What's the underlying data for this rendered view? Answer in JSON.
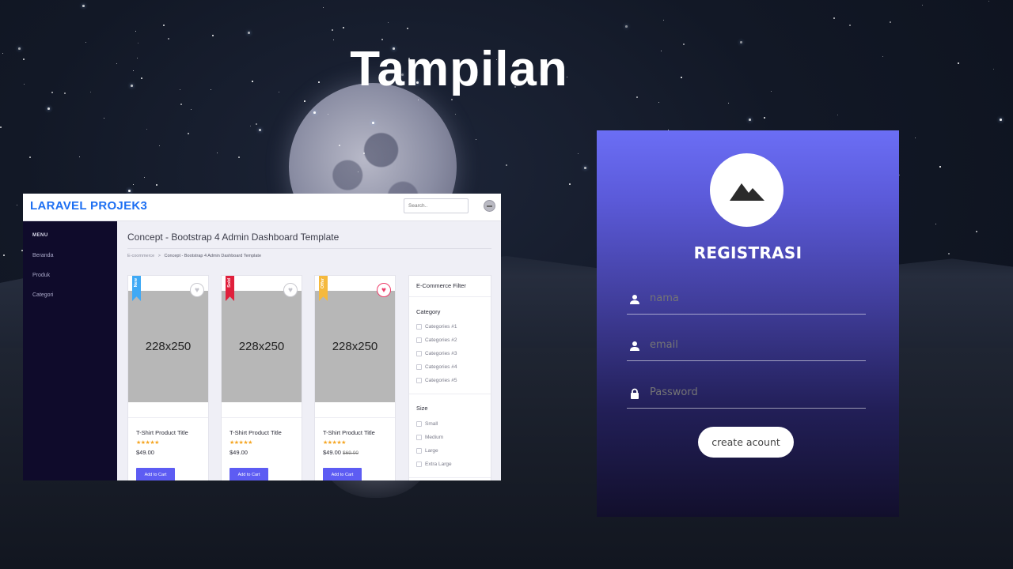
{
  "slide": {
    "title": "Tampilan"
  },
  "dashboard": {
    "brand": "LARAVEL PROJEK3",
    "search_placeholder": "Search..",
    "sidebar": {
      "menu_label": "MENU",
      "items": [
        {
          "label": "Beranda"
        },
        {
          "label": "Produk"
        },
        {
          "label": "Categori"
        }
      ]
    },
    "page_title": "Concept - Bootstrap 4 Admin Dashboard Template",
    "breadcrumb": {
      "root": "E-coommerce",
      "separator": ">",
      "current": "Concept - Bootstrap 4 Admin Dashboard Template"
    },
    "products": [
      {
        "ribbon": "New",
        "ribbon_color": "#3fa9f5",
        "image_text": "228x250",
        "title": "T-Shirt Product Title",
        "stars": "★★★★★",
        "price": "$49.00",
        "old_price": "",
        "cta": "Add to Cart",
        "favorited": false
      },
      {
        "ribbon": "Sold",
        "ribbon_color": "#e0203c",
        "image_text": "228x250",
        "title": "T-Shirt Product Title",
        "stars": "★★★★★",
        "price": "$49.00",
        "old_price": "",
        "cta": "Add to Cart",
        "favorited": false
      },
      {
        "ribbon": "Offer",
        "ribbon_color": "#f5b93d",
        "image_text": "228x250",
        "title": "T-Shirt Product Title",
        "stars": "★★★★★",
        "price": "$49.00",
        "old_price": "$69.00",
        "cta": "Add to Cart",
        "favorited": true
      }
    ],
    "filter": {
      "title": "E-Commerce Filter",
      "category_heading": "Category",
      "categories": [
        "Categories #1",
        "Categories #2",
        "Categories #3",
        "Categories #4",
        "Categories #5"
      ],
      "size_heading": "Size",
      "sizes": [
        "Small",
        "Medium",
        "Large",
        "Extra Large"
      ]
    },
    "colors": {
      "brand": "#1d6ff2",
      "sidebar": "#0f0b2b",
      "button": "#5d5cf3",
      "star": "#f5a623"
    }
  },
  "registration": {
    "title": "REGISTRASI",
    "logo_icon": "mountain-icon",
    "fields": [
      {
        "placeholder": "nama",
        "icon": "user-icon"
      },
      {
        "placeholder": "email",
        "icon": "user-icon"
      },
      {
        "placeholder": "Password",
        "icon": "lock-icon"
      }
    ],
    "submit_label": "create acount",
    "colors": {
      "gradient_top": "#6b6ef5",
      "gradient_bottom": "#120f2c"
    }
  }
}
